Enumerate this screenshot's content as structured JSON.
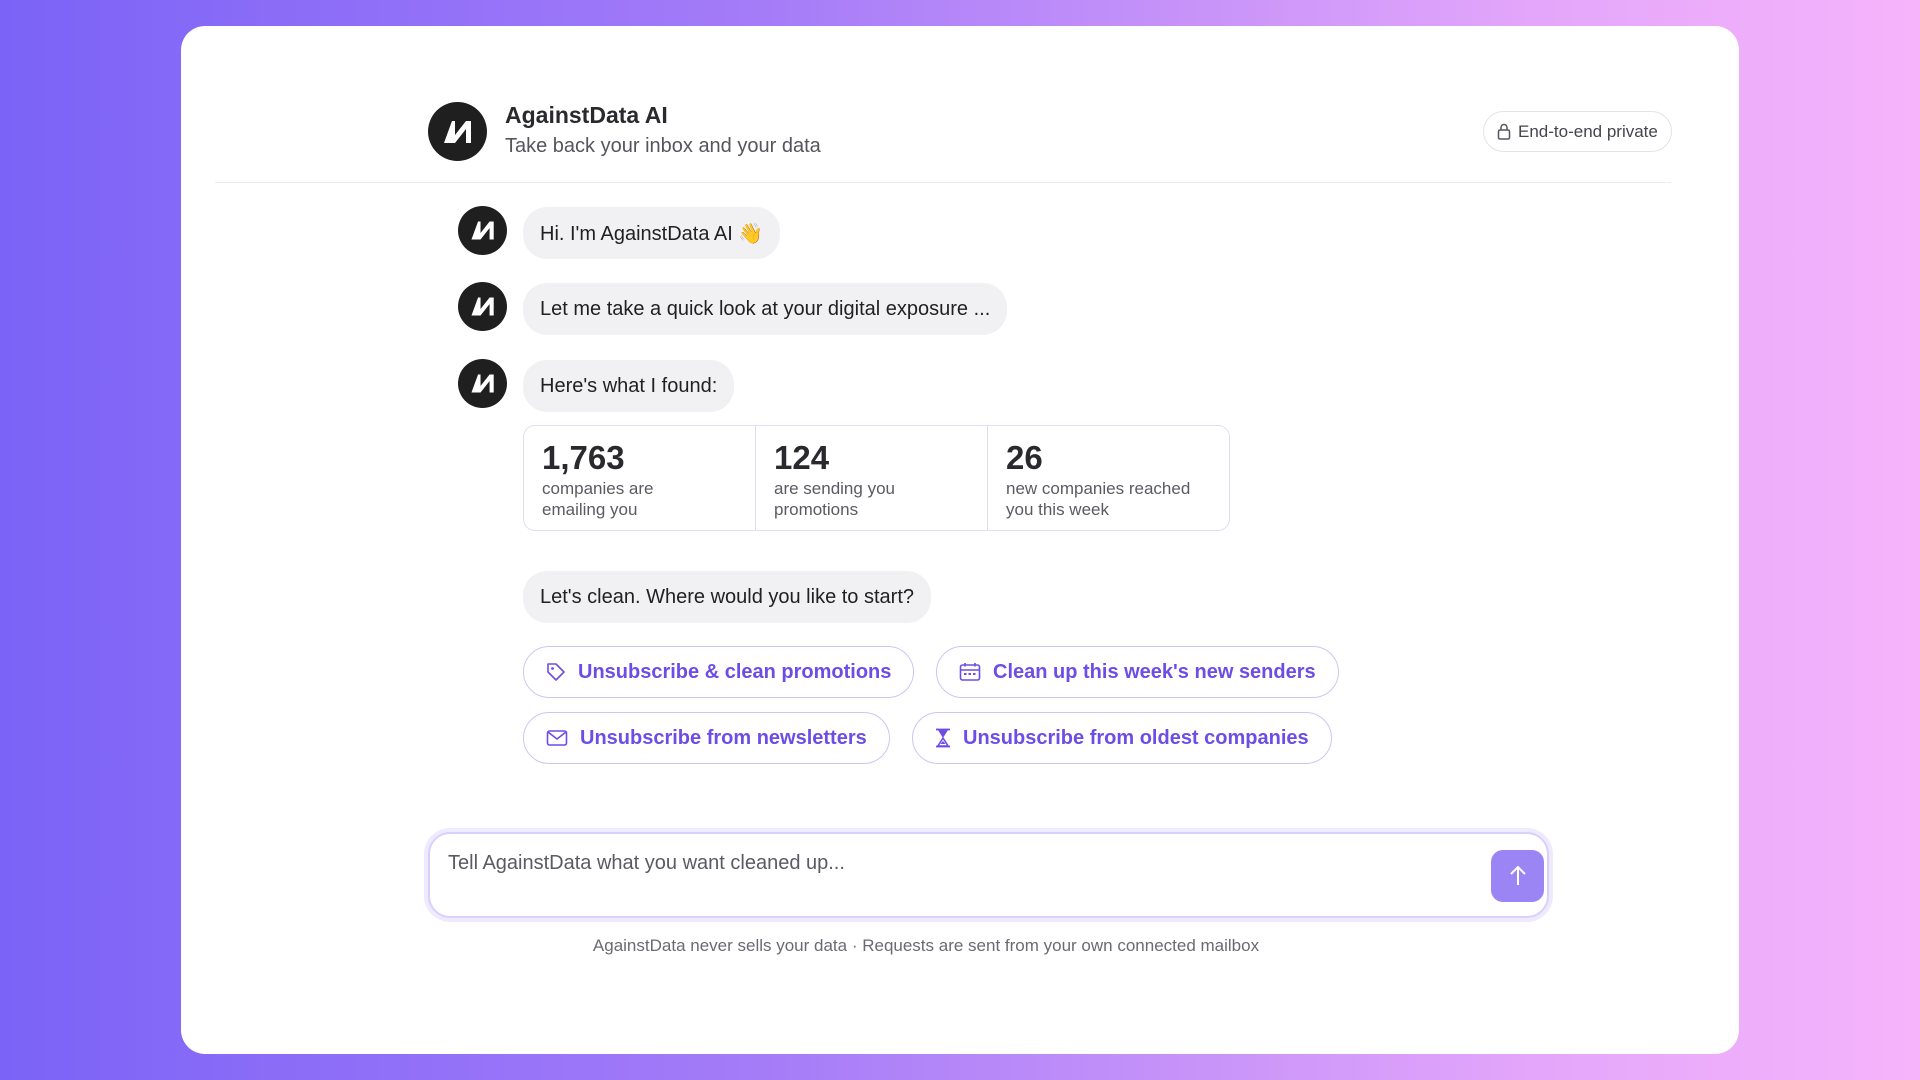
{
  "app": {
    "title": "AgainstData AI",
    "subtitle": "Take back your inbox and your data",
    "privacy_badge": "End-to-end private",
    "accent_color": "#6d4de6"
  },
  "messages": [
    {
      "text": "Hi. I'm AgainstData AI 👋"
    },
    {
      "text": "Let me take a quick look at your digital exposure ..."
    },
    {
      "text": "Here's what I found:"
    }
  ],
  "stats": [
    {
      "value": "1,763",
      "label": "companies are emailing you"
    },
    {
      "value": "124",
      "label": "are sending you promotions"
    },
    {
      "value": "26",
      "label": "new companies reached you this week"
    }
  ],
  "prompt_message": "Let's clean. Where would you like to start?",
  "actions": [
    {
      "label": "Unsubscribe & clean promotions",
      "icon": "tag-icon"
    },
    {
      "label": "Clean up this week's new senders",
      "icon": "calendar-icon"
    },
    {
      "label": "Unsubscribe from newsletters",
      "icon": "envelope-icon"
    },
    {
      "label": "Unsubscribe from oldest companies",
      "icon": "hourglass-icon"
    }
  ],
  "composer": {
    "placeholder": "Tell AgainstData what you want cleaned up...",
    "send_icon": "arrow-up-icon"
  },
  "footer": "AgainstData never sells your data · Requests are sent from your own connected mailbox"
}
